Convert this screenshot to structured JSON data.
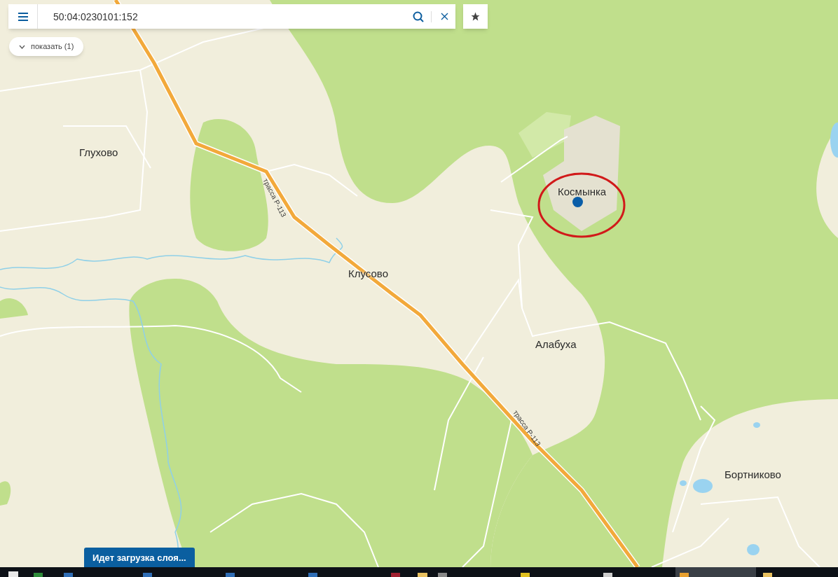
{
  "search": {
    "value": "50:04:0230101:152"
  },
  "show_button": {
    "label": "показать (1)"
  },
  "map": {
    "places": [
      "Глухово",
      "Клусово",
      "Космынка",
      "Алабуха",
      "Бортниково"
    ],
    "road_labels": [
      "трасса Р-113",
      "трасса Р-113"
    ]
  },
  "loading": {
    "text": "Идет загрузка слоя..."
  }
}
